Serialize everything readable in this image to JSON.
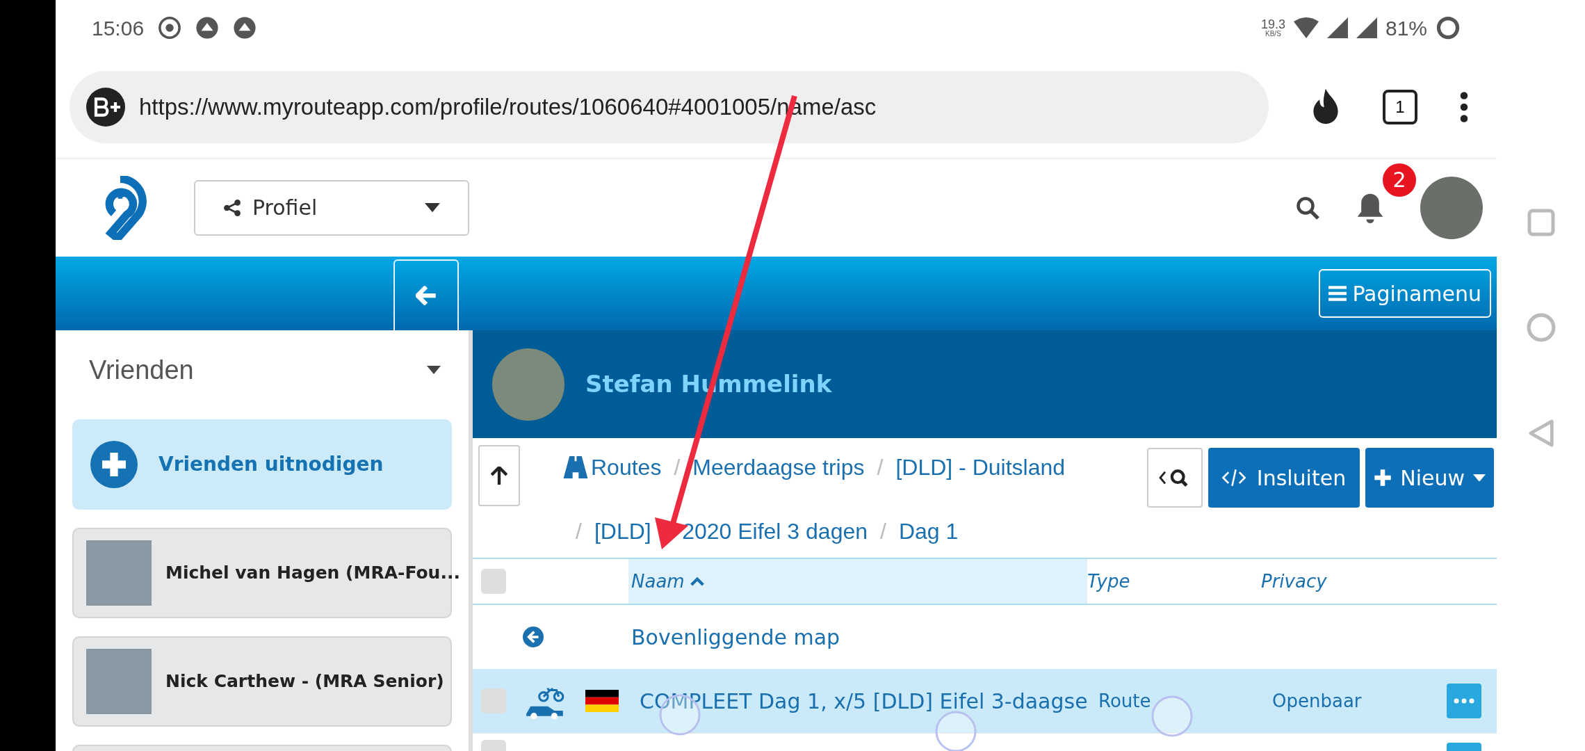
{
  "status_bar": {
    "time": "15:06",
    "net_speed": "19.3",
    "net_unit": "KB/S",
    "battery": "81%"
  },
  "browser": {
    "url": "https://www.myrouteapp.com/profile/routes/1060640#4001005/name/asc",
    "tab_count": "1"
  },
  "header": {
    "dropdown": "Profiel",
    "notifications": "2"
  },
  "page_menu": "Paginamenu",
  "sidebar": {
    "title": "Vrienden",
    "invite": "Vrienden uitnodigen",
    "friends": [
      "Michel van Hagen (MRA-Fou...",
      "Nick Carthew - (MRA Senior)"
    ]
  },
  "profile": {
    "name": "Stefan Hummelink"
  },
  "breadcrumb": [
    {
      "label": "Routes"
    },
    {
      "separator": "/",
      "label": "Meerdaagse trips"
    },
    {
      "separator": "/",
      "label": "[DLD] - Duitsland"
    },
    {
      "separator": "/",
      "label": "[DLD]     2020 Eifel 3 dagen"
    },
    {
      "separator": "/",
      "label": "Dag 1"
    }
  ],
  "actions": {
    "embed": "Insluiten",
    "new": "Nieuw"
  },
  "table": {
    "select_all": {
      "checked": false
    },
    "partial_row": {
      "checked": false
    },
    "columns": [
      {
        "label": "Naam",
        "sorted": true
      },
      {
        "label": "Type",
        "sorted": false
      },
      {
        "label": "Privacy",
        "sorted": false
      }
    ],
    "parent_row": "Bovenliggende map",
    "rows": [
      {
        "name": "COMPLEET Dag 1, x/5 [DLD] Eifel 3-daagse",
        "type": "Route",
        "privacy": "Openbaar",
        "selected": true,
        "checked": false
      }
    ]
  }
}
